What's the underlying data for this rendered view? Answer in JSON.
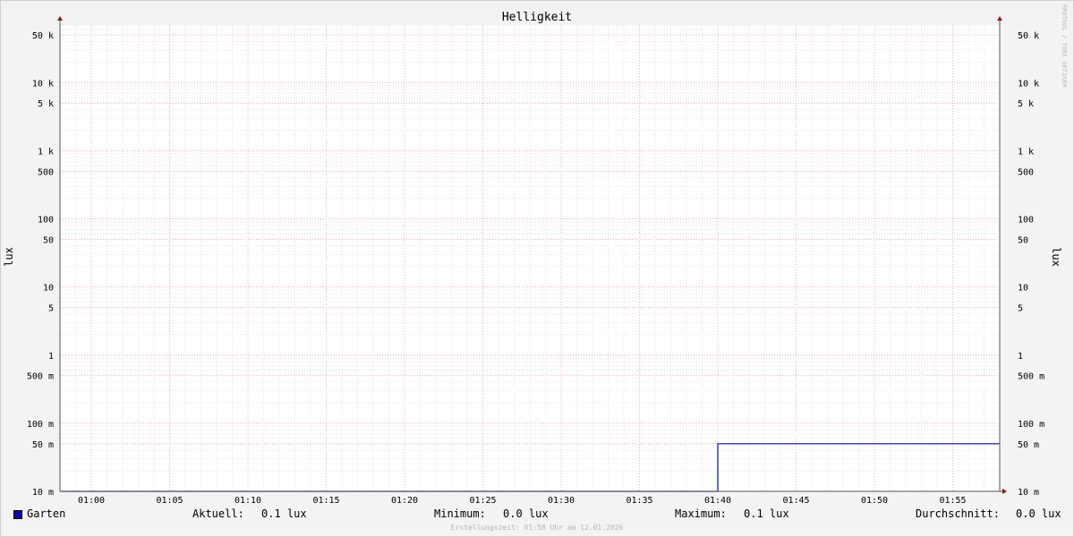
{
  "chart_data": {
    "type": "line",
    "title": "Helligkeit",
    "ylabel": "lux",
    "ylabel_right": "lux",
    "yscale": "log",
    "ylim": [
      0.01,
      70000
    ],
    "y_ticks": [
      {
        "value": 50000,
        "label": "50 k"
      },
      {
        "value": 10000,
        "label": "10 k"
      },
      {
        "value": 5000,
        "label": "5 k"
      },
      {
        "value": 1000,
        "label": "1 k"
      },
      {
        "value": 500,
        "label": "500"
      },
      {
        "value": 100,
        "label": "100"
      },
      {
        "value": 50,
        "label": "50"
      },
      {
        "value": 10,
        "label": "10"
      },
      {
        "value": 5,
        "label": "5"
      },
      {
        "value": 1,
        "label": "1"
      },
      {
        "value": 0.5,
        "label": "500 m"
      },
      {
        "value": 0.1,
        "label": "100 m"
      },
      {
        "value": 0.05,
        "label": "50 m"
      },
      {
        "value": 0.01,
        "label": "10 m"
      }
    ],
    "xlim": [
      "00:58",
      "01:58"
    ],
    "x_ticks": [
      "01:00",
      "01:05",
      "01:10",
      "01:15",
      "01:20",
      "01:25",
      "01:30",
      "01:35",
      "01:40",
      "01:45",
      "01:50",
      "01:55"
    ],
    "grid": true,
    "series": [
      {
        "name": "Garten",
        "color": "#0a0aa0",
        "x": [
          "00:58",
          "01:40",
          "01:40",
          "01:58"
        ],
        "y": [
          0.01,
          0.01,
          0.05,
          0.05
        ]
      }
    ]
  },
  "watermark": "RRDTOOL / TOBI OETIKER",
  "legend": {
    "series_name": "Garten",
    "current_label": "Aktuell:",
    "current_value": "0.1 lux",
    "min_label": "Minimum:",
    "min_value": "0.0 lux",
    "max_label": "Maximum:",
    "max_value": "0.1 lux",
    "avg_label": "Durchschnitt:",
    "avg_value": "0.0 lux"
  },
  "footer": "Erstellungszeit: 01:58 Uhr am 12.01.2026"
}
